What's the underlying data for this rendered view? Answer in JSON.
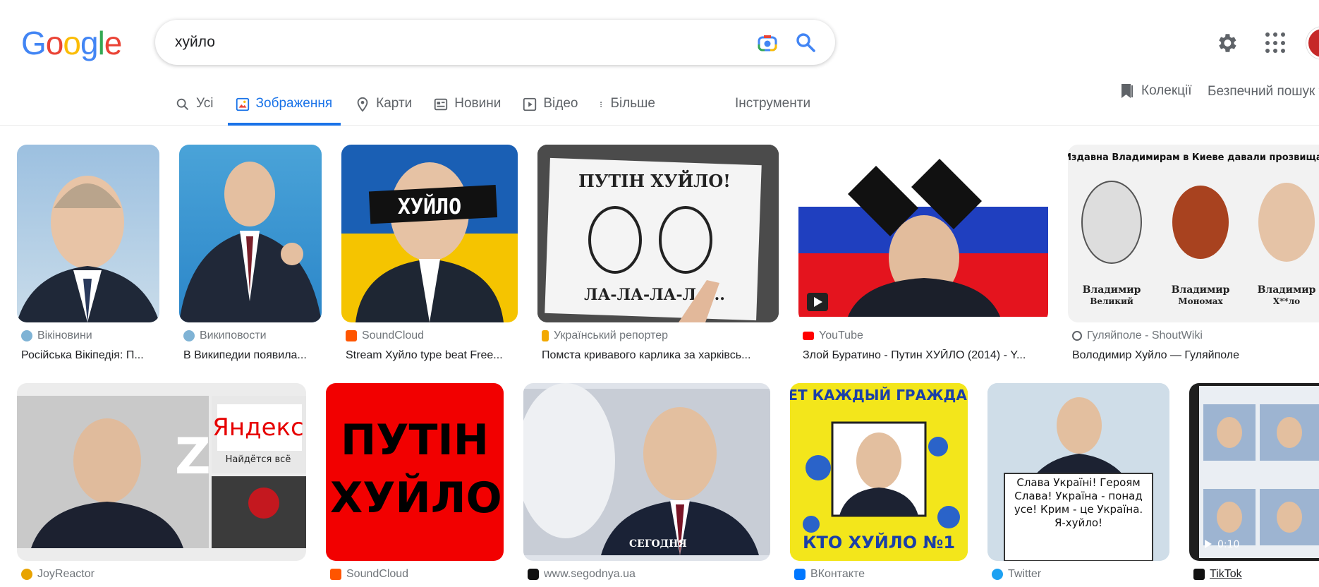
{
  "logo": "Google",
  "search": {
    "query": "хуйло"
  },
  "tabs": [
    {
      "label": "Усі"
    },
    {
      "label": "Зображення"
    },
    {
      "label": "Карти"
    },
    {
      "label": "Новини"
    },
    {
      "label": "Відео"
    },
    {
      "label": "Більше"
    }
  ],
  "tools_label": "Інструменти",
  "collections_label": "Колекції",
  "safe_search_label": "Безпечний пошук",
  "results": [
    {
      "source": "Вікіновини",
      "title": "Російська Вікіпедія: П..."
    },
    {
      "source": "Википовости",
      "title": "В Википедии появила..."
    },
    {
      "source": "SoundCloud",
      "title": "Stream Хуйло type beat Free..."
    },
    {
      "source": "Український репортер",
      "title": "Помста кривавого карлика за харківсь..."
    },
    {
      "source": "YouTube",
      "title": "Злой Буратино - Путин ХУЙЛО (2014) - Y..."
    },
    {
      "source": "Гуляйполе - ShoutWiki",
      "title": "Володимир Хуйло — Гуляйполе"
    },
    {
      "source": "JoyReactor",
      "title": ""
    },
    {
      "source": "SoundCloud",
      "title": ""
    },
    {
      "source": "www.segodnya.ua",
      "title": ""
    },
    {
      "source": "ВКонтакте",
      "title": ""
    },
    {
      "source": "Twitter",
      "title": ""
    },
    {
      "source": "TikTok",
      "title": ""
    }
  ],
  "image_text": {
    "banner_word": "ХУЙЛО",
    "sign_top": "ПУТІН ХУЙЛО!",
    "sign_bottom": "ЛА-ЛА-ЛА-ЛА...",
    "history_header": "Издавна Владимирам в Киеве давали прозвища:",
    "history_names": [
      {
        "name": "Владимир",
        "epithet": "Великий"
      },
      {
        "name": "Владимир",
        "epithet": "Мономах"
      },
      {
        "name": "Владимир",
        "epithet": "Х**ло"
      }
    ],
    "yandex": "Яндекс",
    "yandex_sub": "Найдётся всё",
    "red_poster": "ПУТІН ХУЙЛО",
    "segodnya": "СЕГОДНЯ",
    "vk_top": "ЗНАЕТ КАЖДЫЙ ГРАЖДАНИН",
    "vk_bottom": "КТО ХУЙЛО №1",
    "twitter_sign": "Слава Україні! Героям Слава! Україна - понад усе! Крим - це Україна. Я-хуйло!",
    "tiktok_duration": "0:10"
  },
  "colors": {
    "accent": "#1a73e8",
    "text_secondary": "#70757a"
  }
}
